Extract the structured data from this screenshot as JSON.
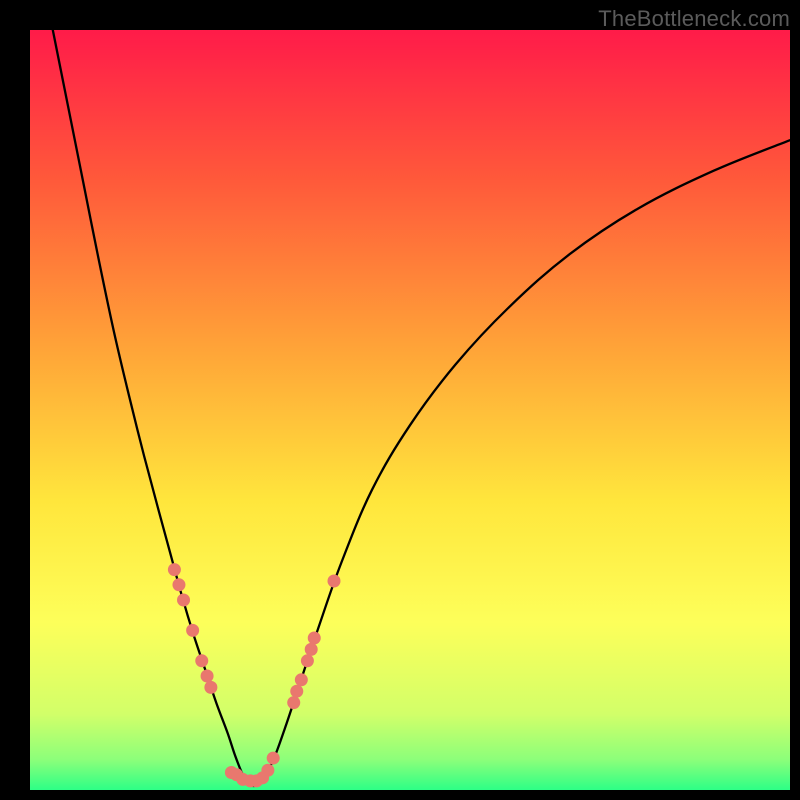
{
  "watermark": "TheBottleneck.com",
  "gradient": {
    "stops": [
      {
        "pct": 0,
        "color": "#ff1b49"
      },
      {
        "pct": 20,
        "color": "#ff5a3a"
      },
      {
        "pct": 42,
        "color": "#ffa438"
      },
      {
        "pct": 62,
        "color": "#ffe63c"
      },
      {
        "pct": 78,
        "color": "#fdff5a"
      },
      {
        "pct": 90,
        "color": "#d2ff69"
      },
      {
        "pct": 96,
        "color": "#8cff7a"
      },
      {
        "pct": 100,
        "color": "#2dff86"
      }
    ]
  },
  "chart_data": {
    "type": "line",
    "title": "",
    "xlabel": "",
    "ylabel": "",
    "xlim": [
      0,
      100
    ],
    "ylim": [
      0,
      100
    ],
    "grid": false,
    "legend": false,
    "annotations": [],
    "series": [
      {
        "name": "curve",
        "stroke": "#000000",
        "stroke_width_px": 2.3,
        "x": [
          3,
          5,
          7,
          9,
          11,
          13,
          15,
          17,
          18.5,
          20,
          21.5,
          23,
          24.5,
          26,
          27,
          28,
          28.8,
          30,
          31.8,
          33.5,
          35.5,
          38,
          41,
          45,
          50,
          56,
          63,
          71,
          80,
          90,
          100
        ],
        "y": [
          100,
          90,
          80,
          70,
          60.5,
          52,
          44,
          36.5,
          31,
          25.5,
          20.5,
          16,
          11.5,
          7.5,
          4.5,
          2,
          0.8,
          0.8,
          3.5,
          8,
          14,
          21.5,
          30,
          39.5,
          48,
          56,
          63.5,
          70.5,
          76.5,
          81.5,
          85.5
        ]
      }
    ],
    "markers": {
      "name": "dots",
      "color": "#e9786e",
      "radius_px": 6.5,
      "points": [
        {
          "x": 19.0,
          "y": 29.0
        },
        {
          "x": 19.6,
          "y": 27.0
        },
        {
          "x": 20.2,
          "y": 25.0
        },
        {
          "x": 21.4,
          "y": 21.0
        },
        {
          "x": 22.6,
          "y": 17.0
        },
        {
          "x": 23.3,
          "y": 15.0
        },
        {
          "x": 23.8,
          "y": 13.5
        },
        {
          "x": 26.5,
          "y": 2.3
        },
        {
          "x": 27.2,
          "y": 2.0
        },
        {
          "x": 28.0,
          "y": 1.4
        },
        {
          "x": 29.0,
          "y": 1.2
        },
        {
          "x": 29.8,
          "y": 1.2
        },
        {
          "x": 30.6,
          "y": 1.6
        },
        {
          "x": 31.3,
          "y": 2.6
        },
        {
          "x": 32.0,
          "y": 4.2
        },
        {
          "x": 34.7,
          "y": 11.5
        },
        {
          "x": 35.1,
          "y": 13.0
        },
        {
          "x": 35.7,
          "y": 14.5
        },
        {
          "x": 36.5,
          "y": 17.0
        },
        {
          "x": 37.0,
          "y": 18.5
        },
        {
          "x": 37.4,
          "y": 20.0
        },
        {
          "x": 40.0,
          "y": 27.5
        }
      ]
    }
  }
}
